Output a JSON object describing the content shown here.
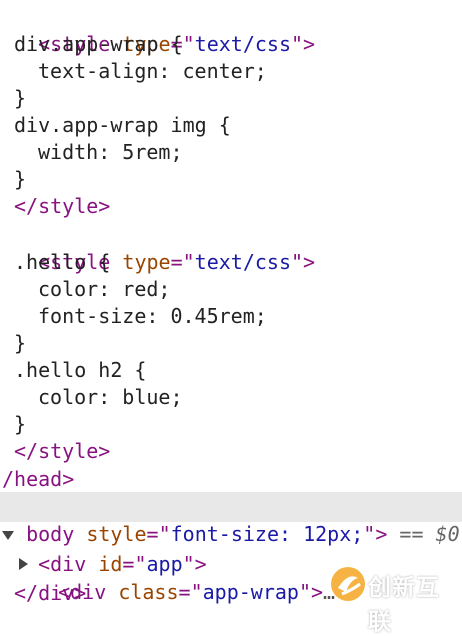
{
  "colors": {
    "tag": "#881280",
    "attribute": "#994500",
    "value": "#1a1aa6",
    "text": "#222222",
    "highlight": "#e8e8e8"
  },
  "lines": [
    {
      "open": "<",
      "tag": "style",
      "attr": "type",
      "eq": "=\"",
      "val": "text/css",
      "close": "\">"
    },
    {
      "text": "div.app-wrap {"
    },
    {
      "text": "text-align: center;"
    },
    {
      "text": "}"
    },
    {
      "text": "div.app-wrap img {"
    },
    {
      "text": "width: 5rem;"
    },
    {
      "text": "}"
    },
    {
      "closetag": "</style>"
    },
    {
      "open": "<",
      "tag": "style",
      "attr": "type",
      "eq": "=\"",
      "val": "text/css",
      "close": "\">"
    },
    {
      "text": ".hello {"
    },
    {
      "text": "color: red;"
    },
    {
      "text": "font-size: 0.45rem;"
    },
    {
      "text": "}"
    },
    {
      "text": ".hello h2 {"
    },
    {
      "text": "color: blue;"
    },
    {
      "text": "}"
    },
    {
      "closetag": "</style>"
    },
    {
      "closetag": "/head>"
    },
    {
      "tag": "body",
      "attr": "style",
      "eq": "=\"",
      "val": "font-size: 12px;",
      "close": "\">",
      "suffix": "== $0"
    },
    {
      "open": "<",
      "tag": "div",
      "attr": "id",
      "eq": "=\"",
      "val": "app",
      "close": "\">"
    },
    {
      "open": "<",
      "tag": "div",
      "attr": "class",
      "eq": "=\"",
      "val": "app-wrap",
      "close": "\">",
      "ellipsis": "… "
    },
    {
      "closetag": "</div>"
    }
  ],
  "watermark": {
    "text": "创新互联",
    "icon": "brand-logo-icon"
  }
}
